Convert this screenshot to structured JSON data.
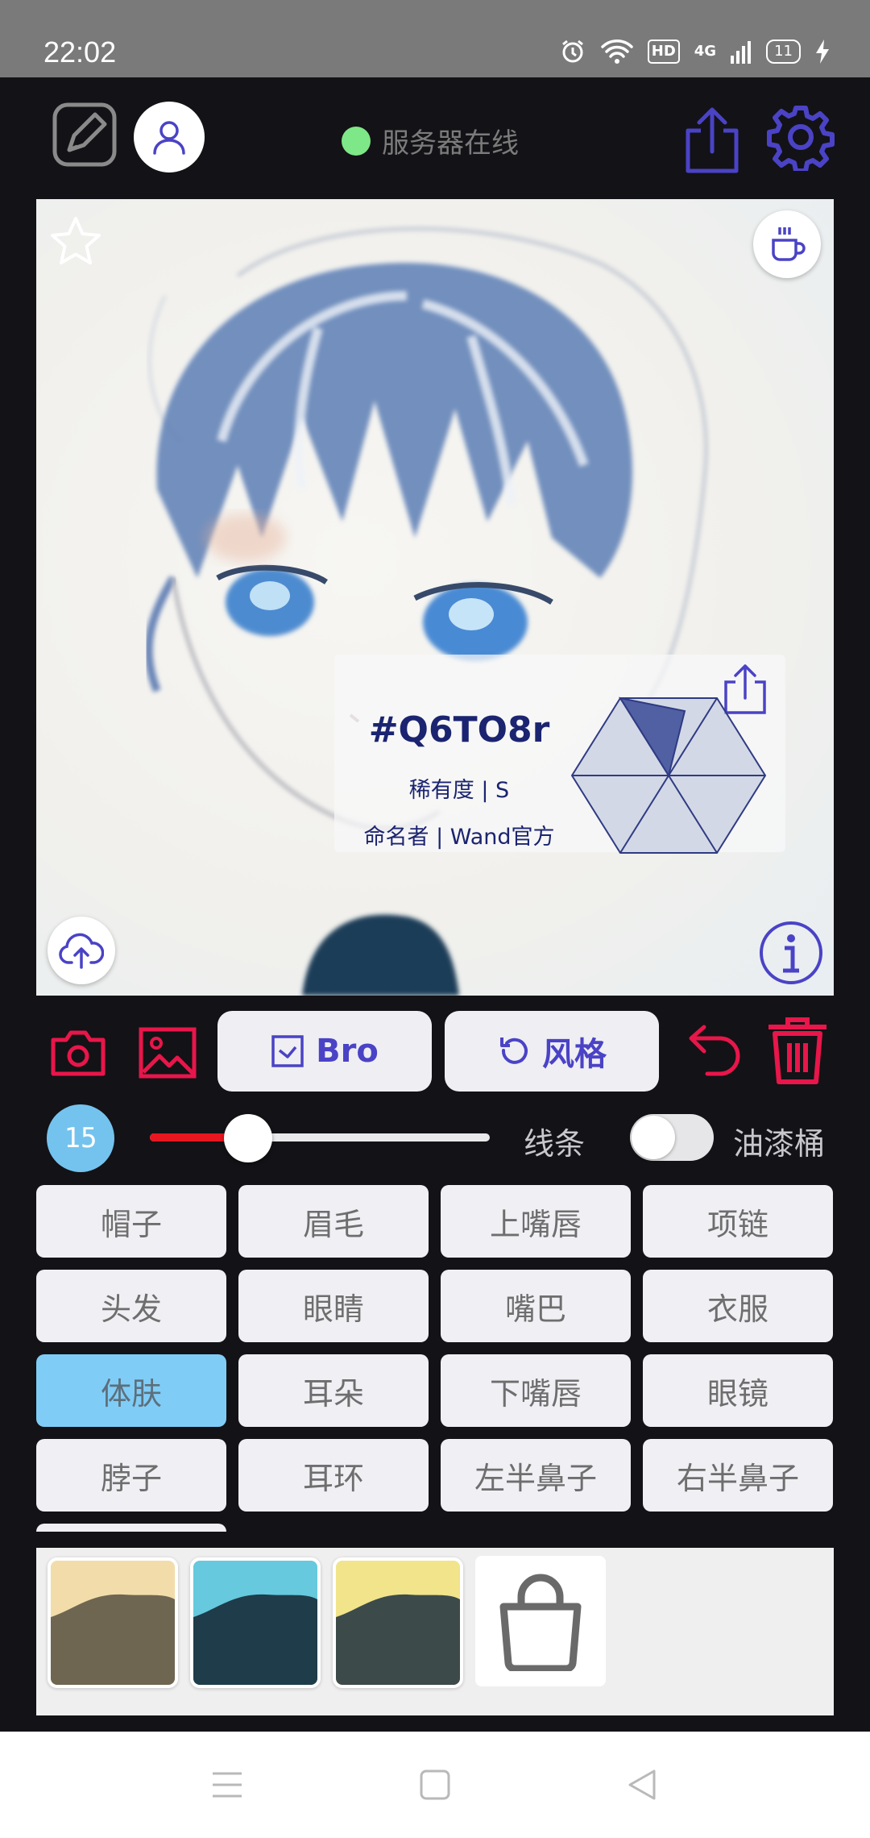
{
  "status_bar": {
    "time": "22:02",
    "hd_label": "HD",
    "network_label": "4G",
    "battery_level": "11"
  },
  "header": {
    "server_status": "服务器在线",
    "server_status_color": "#7ee787"
  },
  "canvas": {
    "card": {
      "id": "#Q6TO8r",
      "rarity": "稀有度 | S",
      "namer": "命名者 | Wand官方"
    }
  },
  "tools": {
    "model_button_label": "Bro",
    "style_button_label": "风格"
  },
  "brush": {
    "size": "15",
    "slider_fraction": 0.29,
    "line_label": "线条",
    "bucket_label": "油漆桶",
    "bucket_enabled": false
  },
  "parts": [
    {
      "label": "帽子",
      "active": false
    },
    {
      "label": "眉毛",
      "active": false
    },
    {
      "label": "上嘴唇",
      "active": false
    },
    {
      "label": "项链",
      "active": false
    },
    {
      "label": "头发",
      "active": false
    },
    {
      "label": "眼睛",
      "active": false
    },
    {
      "label": "嘴巴",
      "active": false
    },
    {
      "label": "衣服",
      "active": false
    },
    {
      "label": "体肤",
      "active": true
    },
    {
      "label": "耳朵",
      "active": false
    },
    {
      "label": "下嘴唇",
      "active": false
    },
    {
      "label": "眼镜",
      "active": false
    },
    {
      "label": "脖子",
      "active": false
    },
    {
      "label": "耳环",
      "active": false
    },
    {
      "label": "左半鼻子",
      "active": false
    },
    {
      "label": "右半鼻子",
      "active": false
    }
  ],
  "palette": {
    "swatches": [
      {
        "top": "#f2ddaa",
        "bottom": "#6f6652"
      },
      {
        "top": "#66c9de",
        "bottom": "#1f3c4a"
      },
      {
        "top": "#f1e48a",
        "bottom": "#3c4b4a"
      }
    ]
  },
  "colors": {
    "accent": "#4a43c6",
    "danger": "#e8164a",
    "selected_part": "#7fcdf7"
  }
}
